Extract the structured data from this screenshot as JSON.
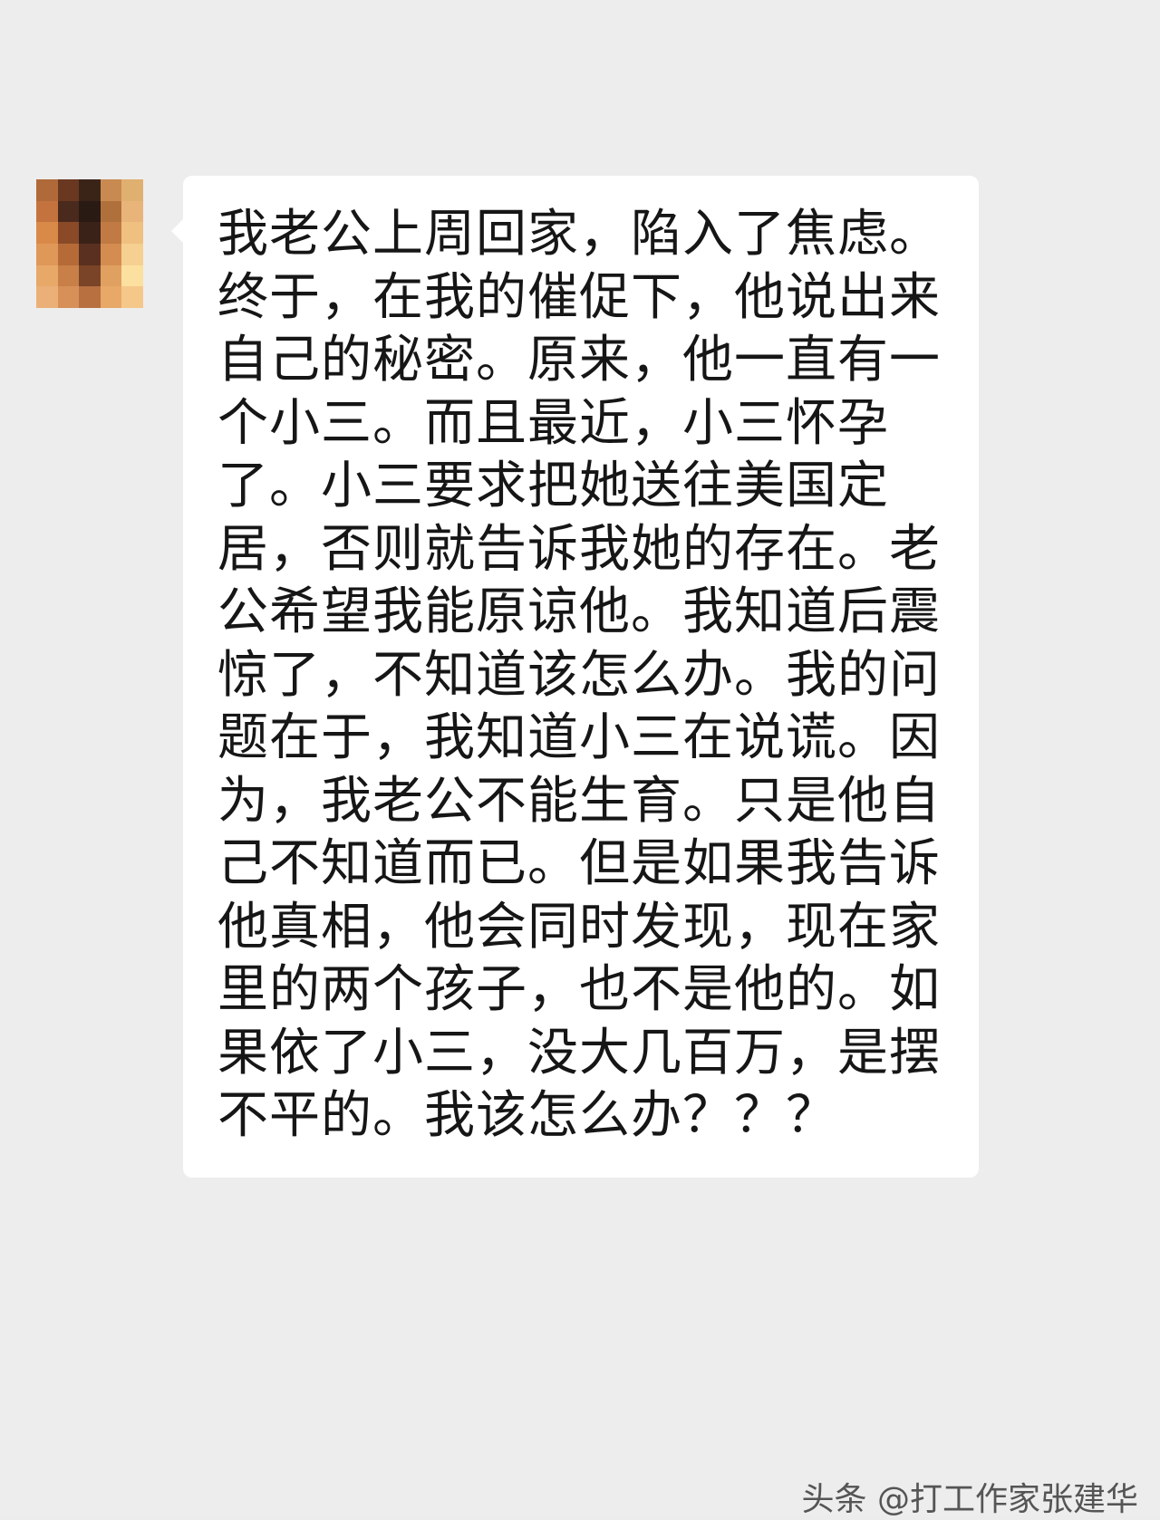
{
  "chat": {
    "message": "我老公上周回家，陷入了焦虑。终于，在我的催促下，他说出来自己的秘密。原来，他一直有一个小三。而且最近，小三怀孕了。小三要求把她送往美国定居，否则就告诉我她的存在。老公希望我能原谅他。我知道后震惊了，不知道该怎么办。我的问题在于，我知道小三在说谎。因为，我老公不能生育。只是他自己不知道而已。但是如果我告诉他真相，他会同时发现，现在家里的两个孩子，也不是他的。如果依了小三，没大几百万，是摆不平的。我该怎么办？？？"
  },
  "watermark": {
    "text": "头条 @打工作家张建华"
  },
  "avatar": {
    "icon": "pixelated-avatar-icon",
    "colors": [
      "#b06a3a",
      "#6a3820",
      "#3a2418",
      "#c98a52",
      "#e0b070",
      "#c5733e",
      "#4a2a1c",
      "#2a1a14",
      "#b0703c",
      "#e8b47a",
      "#d98a48",
      "#8a4a28",
      "#3a2218",
      "#c27a44",
      "#f0c080",
      "#e09858",
      "#b56a38",
      "#5a3020",
      "#d48c50",
      "#f5d090",
      "#e8a868",
      "#c88048",
      "#7a4428",
      "#e0a060",
      "#fce0a0",
      "#eab078",
      "#d69058",
      "#b87040",
      "#e8a868",
      "#f5c88a"
    ]
  }
}
